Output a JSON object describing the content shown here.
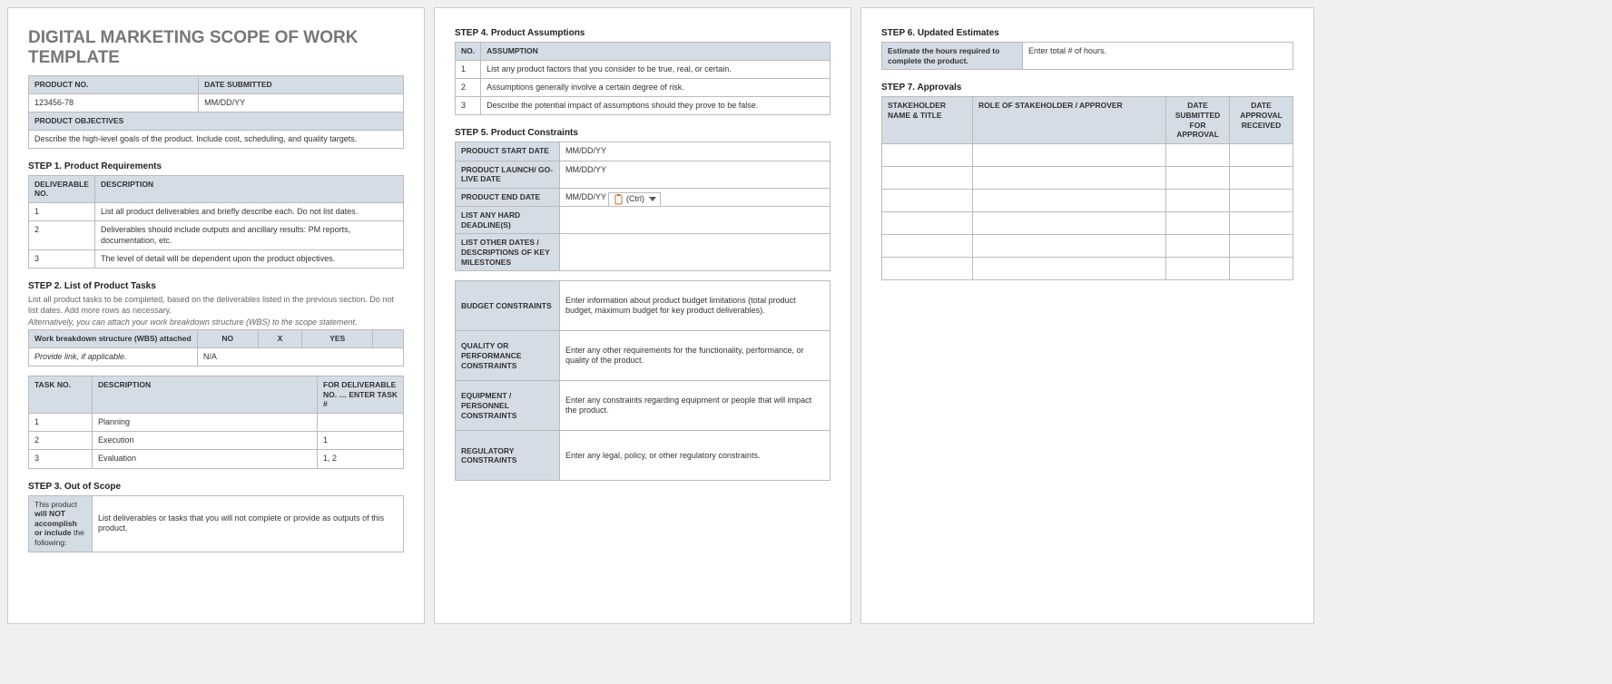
{
  "title": "DIGITAL MARKETING SCOPE OF WORK TEMPLATE",
  "header_table": {
    "h_product_no": "PRODUCT NO.",
    "h_date_submitted": "DATE SUBMITTED",
    "product_no": "123456-78",
    "date_submitted": "MM/DD/YY",
    "h_objectives": "PRODUCT OBJECTIVES",
    "objectives": "Describe the high-level goals of the product.  Include cost, scheduling, and quality targets."
  },
  "step1": {
    "title": "STEP 1. Product Requirements",
    "h_no": "DELIVERABLE NO.",
    "h_desc": "DESCRIPTION",
    "rows": [
      {
        "no": "1",
        "desc": "List all product deliverables and briefly describe each. Do not list dates."
      },
      {
        "no": "2",
        "desc": "Deliverables should include outputs and ancillary results: PM reports, documentation, etc."
      },
      {
        "no": "3",
        "desc": "The level of detail will be dependent upon the product objectives."
      }
    ]
  },
  "step2": {
    "title": "STEP 2. List of Product Tasks",
    "sub1": "List all product tasks to be completed, based on the deliverables listed in the previous section. Do not list dates. Add more rows as necessary.",
    "sub2": "Alternatively, you can attach your work breakdown structure (WBS) to the scope statement.",
    "wbs_label": "Work breakdown structure (WBS) attached",
    "no": "NO",
    "x": "X",
    "yes": "YES",
    "link_label": "Provide link, if applicable.",
    "na": "N/A",
    "h_taskno": "TASK NO.",
    "h_desc": "DESCRIPTION",
    "h_for": "FOR DELIVERABLE NO. … ENTER TASK #",
    "tasks": [
      {
        "no": "1",
        "desc": "Planning",
        "for": ""
      },
      {
        "no": "2",
        "desc": "Execution",
        "for": "1"
      },
      {
        "no": "3",
        "desc": "Evaluation",
        "for": "1, 2"
      }
    ]
  },
  "step3": {
    "title": "STEP 3. Out of Scope",
    "label": "This product will NOT accomplish or include the following:",
    "label_parts": {
      "p1": "This product ",
      "p2": "will NOT accomplish or include",
      "p3": " the following:"
    },
    "value": "List deliverables or tasks that you will not complete or provide as outputs of this product."
  },
  "step4": {
    "title": "STEP 4. Product Assumptions",
    "h_no": "NO.",
    "h_assumption": "ASSUMPTION",
    "rows": [
      {
        "no": "1",
        "desc": "List any product factors that you consider to be true, real, or certain."
      },
      {
        "no": "2",
        "desc": "Assumptions generally involve a certain degree of risk."
      },
      {
        "no": "3",
        "desc": "Describe the potential impact of assumptions should they prove to be false."
      }
    ]
  },
  "step5": {
    "title": "STEP 5. Product Constraints",
    "r_start": "PRODUCT START DATE",
    "v_start": "MM/DD/YY",
    "r_launch": "PRODUCT LAUNCH/ GO-LIVE DATE",
    "v_launch": "MM/DD/YY",
    "r_end": "PRODUCT END DATE",
    "v_end": "MM/DD/YY",
    "r_hard": "LIST ANY HARD DEADLINE(S)",
    "r_other": "LIST OTHER DATES / DESCRIPTIONS OF KEY MILESTONES",
    "r_budget": "BUDGET CONSTRAINTS",
    "v_budget": "Enter information about product budget limitations (total product budget, maximum budget for key product deliverables).",
    "r_quality": "QUALITY OR PERFORMANCE CONSTRAINTS",
    "v_quality": "Enter any other requirements for the functionality, performance, or quality of the product.",
    "r_equip": "EQUIPMENT / PERSONNEL CONSTRAINTS",
    "v_equip": "Enter any constraints regarding equipment or people that will impact the product.",
    "r_reg": "REGULATORY CONSTRAINTS",
    "v_reg": "Enter any legal, policy, or other regulatory constraints."
  },
  "ctrl_label": "(Ctrl)",
  "step6": {
    "title": "STEP 6. Updated Estimates",
    "label": "Estimate the hours required to complete the product.",
    "value": "Enter total # of hours."
  },
  "step7": {
    "title": "STEP 7. Approvals",
    "h_name": "STAKEHOLDER NAME & TITLE",
    "h_role": "ROLE OF STAKEHOLDER / APPROVER",
    "h_sub": "DATE SUBMITTED FOR APPROVAL",
    "h_rec": "DATE APPROVAL RECEIVED"
  }
}
